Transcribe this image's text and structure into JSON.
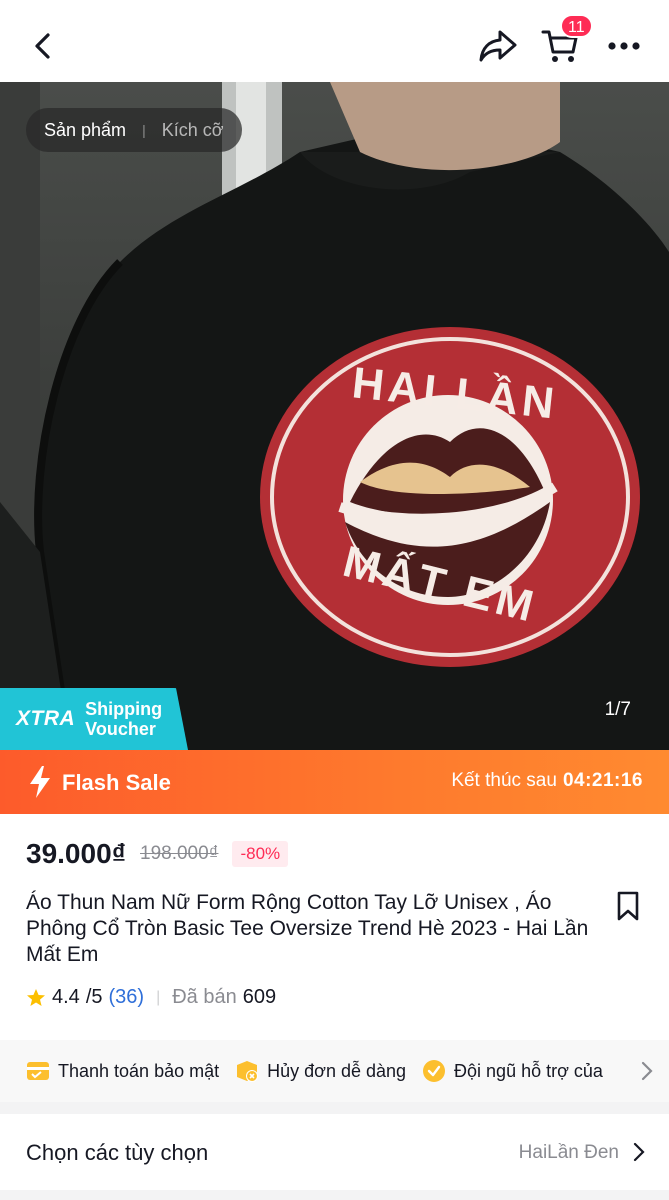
{
  "header": {
    "cart_count": "11",
    "icons": [
      "back-icon",
      "share-icon",
      "cart-icon",
      "more-icon"
    ]
  },
  "hero": {
    "tabs": [
      "Sản phẩm",
      "Kích cỡ"
    ],
    "counter": "1/7",
    "xtra": {
      "logo": "XTRA",
      "line1": "Shipping",
      "line2": "Voucher"
    },
    "print": {
      "top": "HAI LẦN",
      "bottom": "MẤT EM"
    }
  },
  "flash": {
    "label": "Flash Sale",
    "end_label": "Kết thúc sau",
    "timer": "04:21:16"
  },
  "product": {
    "price": "39.000₫",
    "original_price": "198.000₫",
    "discount": "-80%",
    "title": "Áo Thun Nam Nữ Form Rộng Cotton Tay Lỡ Unisex , Áo Phông Cổ Tròn Basic Tee Oversize Trend Hè 2023 - Hai Lần Mất Em",
    "rating": "4.4",
    "rating_suffix": "/5",
    "review_count": "(36)",
    "sold_label": "Đã bán",
    "sold_value": "609"
  },
  "guarantees": [
    {
      "label": "Thanh toán bảo mật",
      "icon": "card-icon"
    },
    {
      "label": "Hủy đơn dễ dàng",
      "icon": "cancel-box-icon"
    },
    {
      "label": "Đội ngũ hỗ trợ của",
      "icon": "support-check-icon"
    }
  ],
  "options": {
    "label": "Chọn các tùy chọn",
    "value": "HaiLần Đen"
  },
  "colors": {
    "accent": "#fe2c55",
    "flash": "#fd5b2b",
    "xtra": "#21c4d6",
    "link": "#2f6fd9",
    "star": "#fcbf00"
  }
}
